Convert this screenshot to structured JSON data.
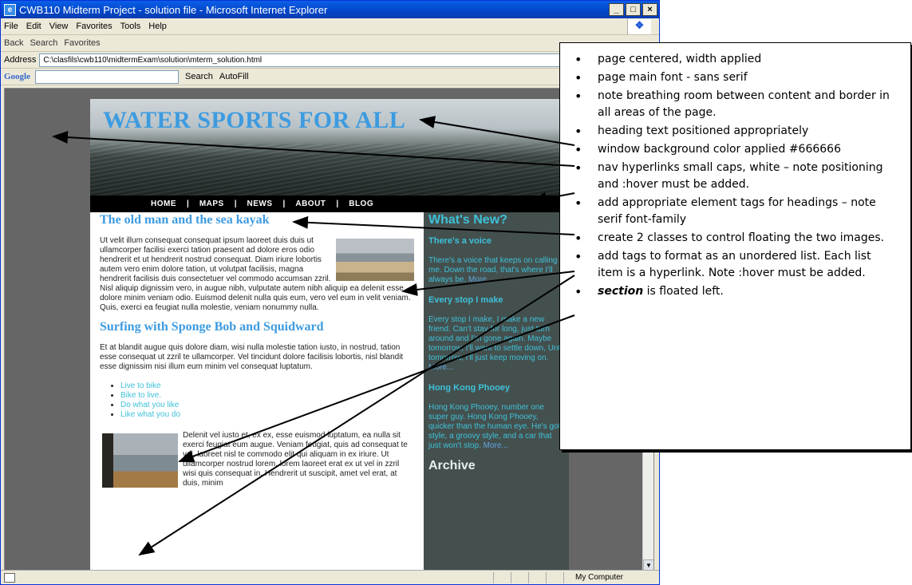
{
  "window": {
    "title": "CWB110 Midterm Project - solution file - Microsoft Internet Explorer",
    "controls": [
      "_",
      "□",
      "×"
    ]
  },
  "menu": [
    "File",
    "Edit",
    "View",
    "Favorites",
    "Tools",
    "Help"
  ],
  "toolbar": [
    "Back",
    "Search",
    "Favorites"
  ],
  "address": {
    "label": "Address",
    "value": "C:\\clasfils\\cwb110\\midtermExam\\solution\\mterm_solution.html"
  },
  "googlebar": {
    "logo": "Google",
    "search": "Search",
    "autofill": "AutoFill"
  },
  "site": {
    "banner_title": "WATER SPORTS FOR ALL",
    "nav": [
      "HOME",
      "MAPS",
      "NEWS",
      "ABOUT",
      "BLOG"
    ],
    "section": {
      "h1": "The old man and the sea kayak",
      "p1": "Ut velit illum consequat consequat ipsum laoreet duis duis ut ullamcorper facilisi exerci tation praesent ad dolore eros odio hendrerit et ut hendrerit nostrud consequat. Diam iriure lobortis autem vero enim dolore tation, ut volutpat facilisis, magna hendrerit facilisis duis consectetuer vel commodo accumsan zzril. Nisl aliquip dignissim vero, in augue nibh, vulputate autem nibh aliquip ea delenit esse dolore minim veniam odio. Euismod delenit nulla quis eum, vero vel eum in velit veniam. Quis, exerci ea feugiat nulla molestie, veniam nonummy nulla.",
      "h2": "Surfing with Sponge Bob and Squidward",
      "p2": "Et at blandit augue quis dolore diam, wisi nulla molestie tation iusto, in nostrud, tation esse consequat ut zzril te ullamcorper. Vel tincidunt dolore facilisis lobortis, nisl blandit esse dignissim nisi illum eum minim vel consequat luptatum.",
      "list": [
        "Live to bike",
        "Bike to live.",
        "Do what you like",
        "Like what you do"
      ],
      "p3": "Delenit vel iusto et, ex ex, esse euismod luptatum, ea nulla sit exerci feugiat eum augue. Veniam feugiat, quis ad consequat te vel, laoreet nisl te commodo elit qui aliquam in ex iriure. Ut ullamcorper nostrud lorem, lorem laoreet erat ex ut vel in zzril wisi quis consequat in. Hendrerit ut suscipit, amet vel erat, at duis, minim"
    },
    "aside": {
      "heading": "What's New?",
      "items": [
        {
          "title": "There's a voice",
          "text": "There's a voice that keeps on calling me. Down the road, that's where I'll always be.",
          "more": "More..."
        },
        {
          "title": "Every stop I make",
          "text": "Every stop I make, I make a new friend. Can't stay for long, just turn around and I'm gone again. Maybe tomorrow, I'll want to settle down, Until tomorrow, I'll just keep moving on.",
          "more": "More..."
        },
        {
          "title": "Hong Kong Phooey",
          "text": "Hong Kong Phooey, number one super guy. Hong Kong Phooey, quicker than the human eye. He's got style, a groovy style, and a car that just won't stop.",
          "more": "More..."
        }
      ],
      "archive": "Archive"
    }
  },
  "status": {
    "zone": "My Computer"
  },
  "notes": [
    "page centered, width applied",
    "page main font  - sans serif",
    "note breathing room between content and border in all areas of the page.",
    "heading text positioned  appropriately",
    "window background color applied #666666",
    "nav hyperlinks small caps, white – note positioning and :hover must be added.",
    "add appropriate element tags for headings – note serif font-family",
    "create 2 classes to control floating the two images.",
    "add tags to format as an unordered list. Each list item is a hyperlink. Note :hover must be added.",
    "section"
  ],
  "notes_last_suffix": " is floated left."
}
